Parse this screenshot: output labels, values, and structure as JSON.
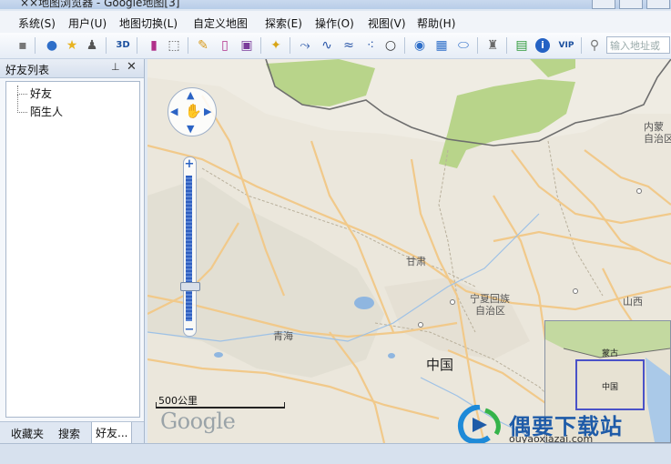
{
  "window": {
    "title": "××地图浏览器 - Google地图[3]"
  },
  "menu": [
    "系统(S)",
    "用户(U)",
    "地图切换(L)",
    "自定义地图",
    "探索(E)",
    "操作(O)",
    "视图(V)",
    "帮助(H)"
  ],
  "toolbar": {
    "label_3d": "3D",
    "label_vip": "VIP",
    "search_placeholder": "输入地址或"
  },
  "panel": {
    "title": "好友列表",
    "tree": [
      "好友",
      "陌生人"
    ],
    "tabs": [
      "收藏夹",
      "搜索",
      "好友..."
    ]
  },
  "map": {
    "places": {
      "inner_mongolia_1": "内蒙",
      "inner_mongolia_2": "自治区",
      "gansu": "甘肃",
      "ningxia_1": "宁夏回族",
      "ningxia_2": "自治区",
      "shanxi": "山西",
      "qinghai": "青海",
      "china": "中国"
    },
    "scale_label": "500公里",
    "logo": "Google",
    "overview": {
      "mongolia": "蒙古",
      "china": "中国"
    }
  },
  "watermark": {
    "title": "偶要下载站",
    "url": "ouyaoxiazai.com"
  },
  "colors": {
    "accent": "#2b63c4",
    "steppe_green": "#b8d48a",
    "road": "#f1c98a",
    "water": "#8fb6e0"
  }
}
